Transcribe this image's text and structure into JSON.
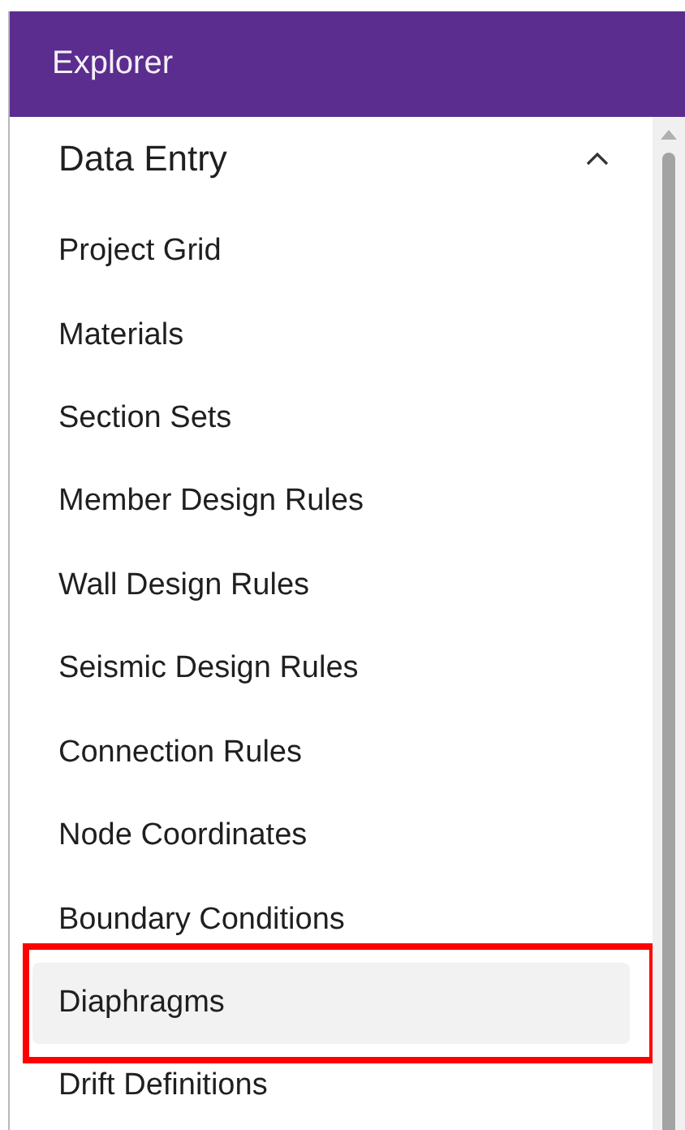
{
  "header": {
    "title": "Explorer"
  },
  "section": {
    "title": "Data Entry",
    "expanded": true,
    "items": [
      {
        "label": "Project Grid",
        "selected": false
      },
      {
        "label": "Materials",
        "selected": false
      },
      {
        "label": "Section Sets",
        "selected": false
      },
      {
        "label": "Member Design Rules",
        "selected": false
      },
      {
        "label": "Wall Design Rules",
        "selected": false
      },
      {
        "label": "Seismic Design Rules",
        "selected": false
      },
      {
        "label": "Connection Rules",
        "selected": false
      },
      {
        "label": "Node Coordinates",
        "selected": false
      },
      {
        "label": "Boundary Conditions",
        "selected": false
      },
      {
        "label": "Diaphragms",
        "selected": true
      },
      {
        "label": "Drift Definitions",
        "selected": false
      }
    ]
  }
}
